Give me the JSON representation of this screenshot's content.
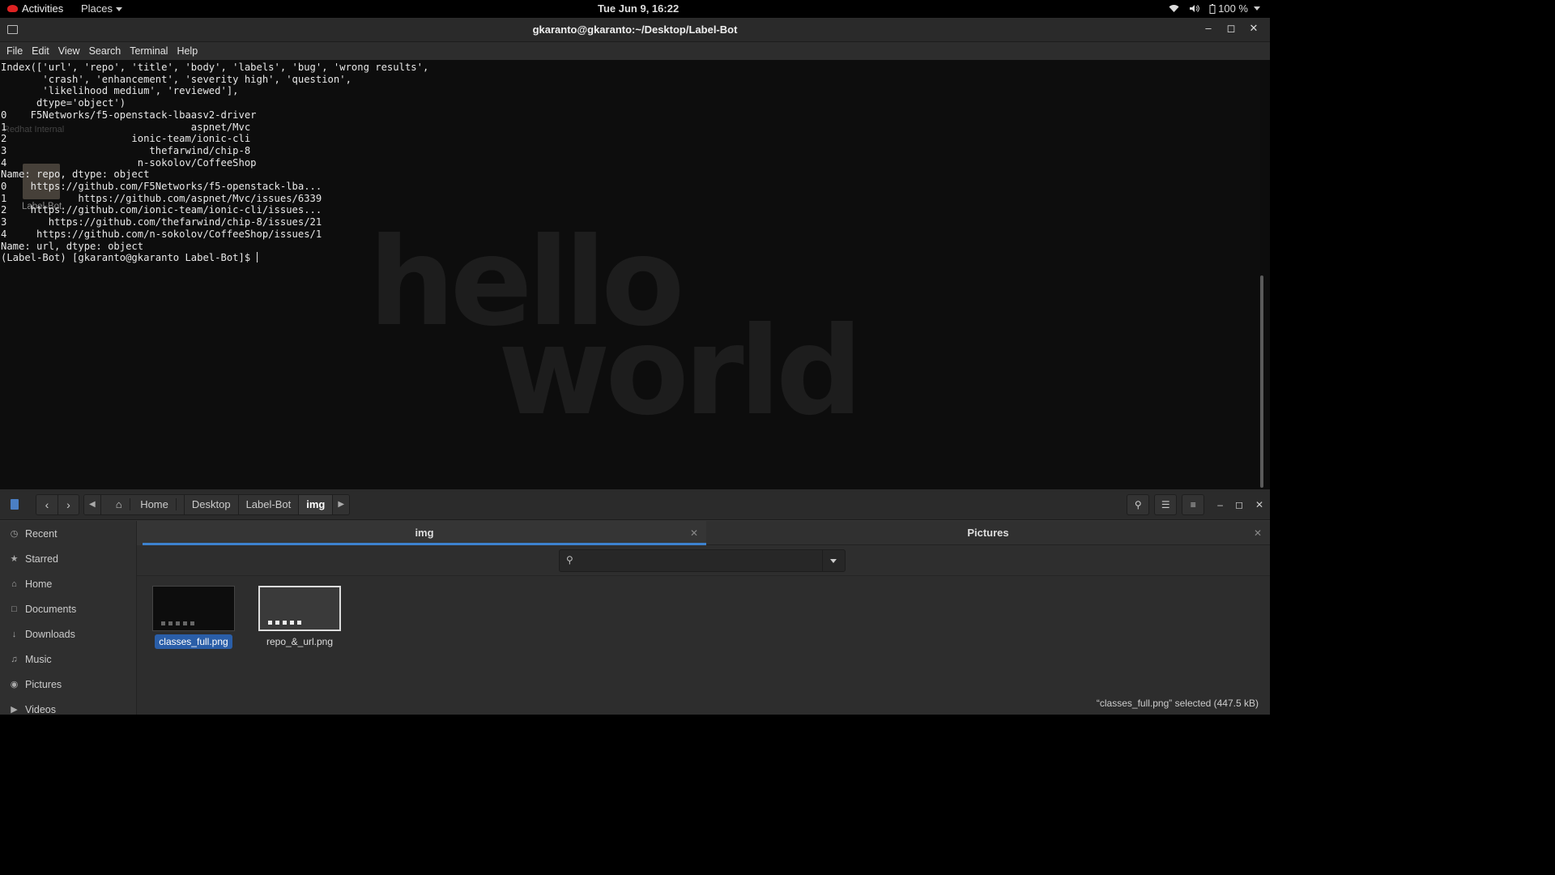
{
  "topbar": {
    "activities": "Activities",
    "places": "Places",
    "clock": "Tue Jun  9, 16:22",
    "battery": "100 %"
  },
  "desktop": {
    "ghost_label": "Redhat Internal",
    "icon_label": "Label-Bot"
  },
  "terminal": {
    "title": "gkaranto@gkaranto:~/Desktop/Label-Bot",
    "menu": [
      "File",
      "Edit",
      "View",
      "Search",
      "Terminal",
      "Help"
    ],
    "lines": [
      "Index(['url', 'repo', 'title', 'body', 'labels', 'bug', 'wrong results',",
      "       'crash', 'enhancement', 'severity high', 'question',",
      "       'likelihood medium', 'reviewed'],",
      "      dtype='object')",
      "",
      "0    F5Networks/f5-openstack-lbaasv2-driver",
      "1                               aspnet/Mvc",
      "2                     ionic-team/ionic-cli",
      "3                        thefarwind/chip-8",
      "4                      n-sokolov/CoffeeShop",
      "Name: repo, dtype: object",
      "",
      "0    https://github.com/F5Networks/f5-openstack-lba...",
      "1            https://github.com/aspnet/Mvc/issues/6339",
      "2    https://github.com/ionic-team/ionic-cli/issues...",
      "3       https://github.com/thefarwind/chip-8/issues/21",
      "4     https://github.com/n-sokolov/CoffeeShop/issues/1",
      "Name: url, dtype: object"
    ],
    "prompt": "(Label-Bot) [gkaranto@gkaranto Label-Bot]$ ",
    "wallpaper_line1": "hello",
    "wallpaper_line2": "world"
  },
  "files": {
    "path": [
      "Home",
      "Desktop",
      "Label-Bot",
      "img"
    ],
    "sidebar": [
      "Recent",
      "Starred",
      "Home",
      "Documents",
      "Downloads",
      "Music",
      "Pictures",
      "Videos"
    ],
    "tabs": [
      {
        "label": "img",
        "active": true
      },
      {
        "label": "Pictures",
        "active": false
      }
    ],
    "items": [
      {
        "name": "classes_full.png",
        "selected": true
      },
      {
        "name": "repo_&_url.png",
        "selected": false
      }
    ],
    "status": "“classes_full.png” selected  (447.5 kB)"
  }
}
